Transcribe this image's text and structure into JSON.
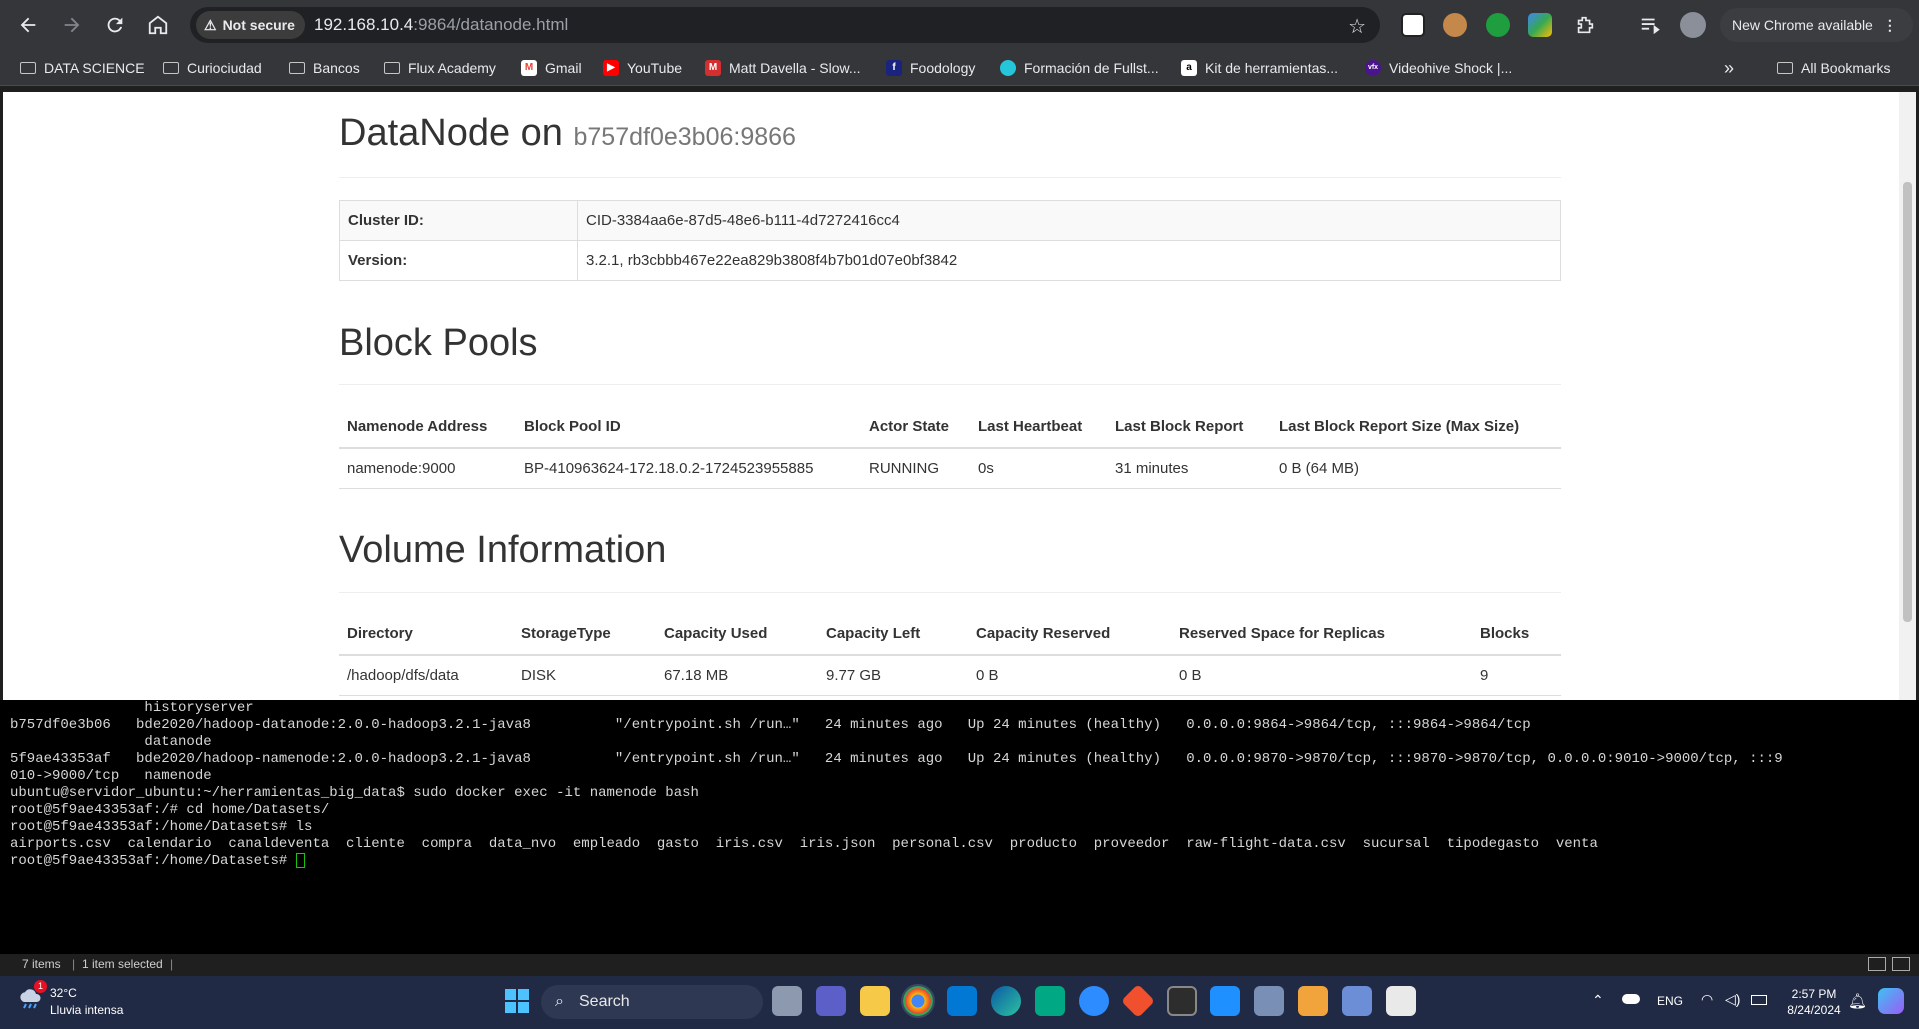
{
  "browser": {
    "security_label": "Not secure",
    "url_host": "192.168.10.4",
    "url_rest": ":9864/datanode.html",
    "update_button": "New Chrome available",
    "bookmarks": [
      {
        "label": "DATA SCIENCE",
        "icon": "folder-icon"
      },
      {
        "label": "Curiociudad",
        "icon": "folder-icon"
      },
      {
        "label": "Bancos",
        "icon": "folder-icon"
      },
      {
        "label": "Flux Academy",
        "icon": "folder-icon"
      },
      {
        "label": "Gmail",
        "icon": "gmail-icon"
      },
      {
        "label": "YouTube",
        "icon": "youtube-icon"
      },
      {
        "label": "Matt Davella - Slow...",
        "icon": "m-icon"
      },
      {
        "label": "Foodology",
        "icon": "foodology-icon"
      },
      {
        "label": "Formación de Fullst...",
        "icon": "globe-icon"
      },
      {
        "label": "Kit de herramientas...",
        "icon": "amazon-icon"
      },
      {
        "label": "Videohive Shock |...",
        "icon": "vfx-icon"
      }
    ],
    "all_bookmarks": "All Bookmarks",
    "overflow": "»"
  },
  "page": {
    "title": "DataNode on",
    "host": "b757df0e3b06:9866",
    "info": [
      {
        "key": "Cluster ID:",
        "value": "CID-3384aa6e-87d5-48e6-b111-4d7272416cc4"
      },
      {
        "key": "Version:",
        "value": "3.2.1, rb3cbbb467e22ea829b3808f4b7b01d07e0bf3842"
      }
    ],
    "block_pools": {
      "heading": "Block Pools",
      "columns": [
        "Namenode Address",
        "Block Pool ID",
        "Actor State",
        "Last Heartbeat",
        "Last Block Report",
        "Last Block Report Size (Max Size)"
      ],
      "rows": [
        [
          "namenode:9000",
          "BP-410963624-172.18.0.2-1724523955885",
          "RUNNING",
          "0s",
          "31 minutes",
          "0 B (64 MB)"
        ]
      ]
    },
    "volumes": {
      "heading": "Volume Information",
      "columns": [
        "Directory",
        "StorageType",
        "Capacity Used",
        "Capacity Left",
        "Capacity Reserved",
        "Reserved Space for Replicas",
        "Blocks"
      ],
      "rows": [
        [
          "/hadoop/dfs/data",
          "DISK",
          "67.18 MB",
          "9.77 GB",
          "0 B",
          "0 B",
          "9"
        ]
      ]
    }
  },
  "terminal": {
    "lines": [
      "                historyserver",
      "b757df0e3b06   bde2020/hadoop-datanode:2.0.0-hadoop3.2.1-java8          \"/entrypoint.sh /run…\"   24 minutes ago   Up 24 minutes (healthy)   0.0.0.0:9864->9864/tcp, :::9864->9864/tcp",
      "                datanode",
      "5f9ae43353af   bde2020/hadoop-namenode:2.0.0-hadoop3.2.1-java8          \"/entrypoint.sh /run…\"   24 minutes ago   Up 24 minutes (healthy)   0.0.0.0:9870->9870/tcp, :::9870->9870/tcp, 0.0.0.0:9010->9000/tcp, :::9",
      "010->9000/tcp   namenode",
      "ubuntu@servidor_ubuntu:~/herramientas_big_data$ sudo docker exec -it namenode bash",
      "root@5f9ae43353af:/# cd home/Datasets/",
      "root@5f9ae43353af:/home/Datasets# ls",
      "airports.csv  calendario  canaldeventa  cliente  compra  data_nvo  empleado  gasto  iris.csv  iris.json  personal.csv  producto  proveedor  raw-flight-data.csv  sucursal  tipodegasto  venta"
    ],
    "prompt": "root@5f9ae43353af:/home/Datasets# "
  },
  "explorer_status": {
    "items": "7 items",
    "selected": "1 item selected"
  },
  "taskbar": {
    "temperature": "32°C",
    "weather": "Lluvia intensa",
    "weather_badge": "1",
    "search": "Search",
    "language": "ENG",
    "time": "2:57 PM",
    "date": "8/24/2024"
  }
}
